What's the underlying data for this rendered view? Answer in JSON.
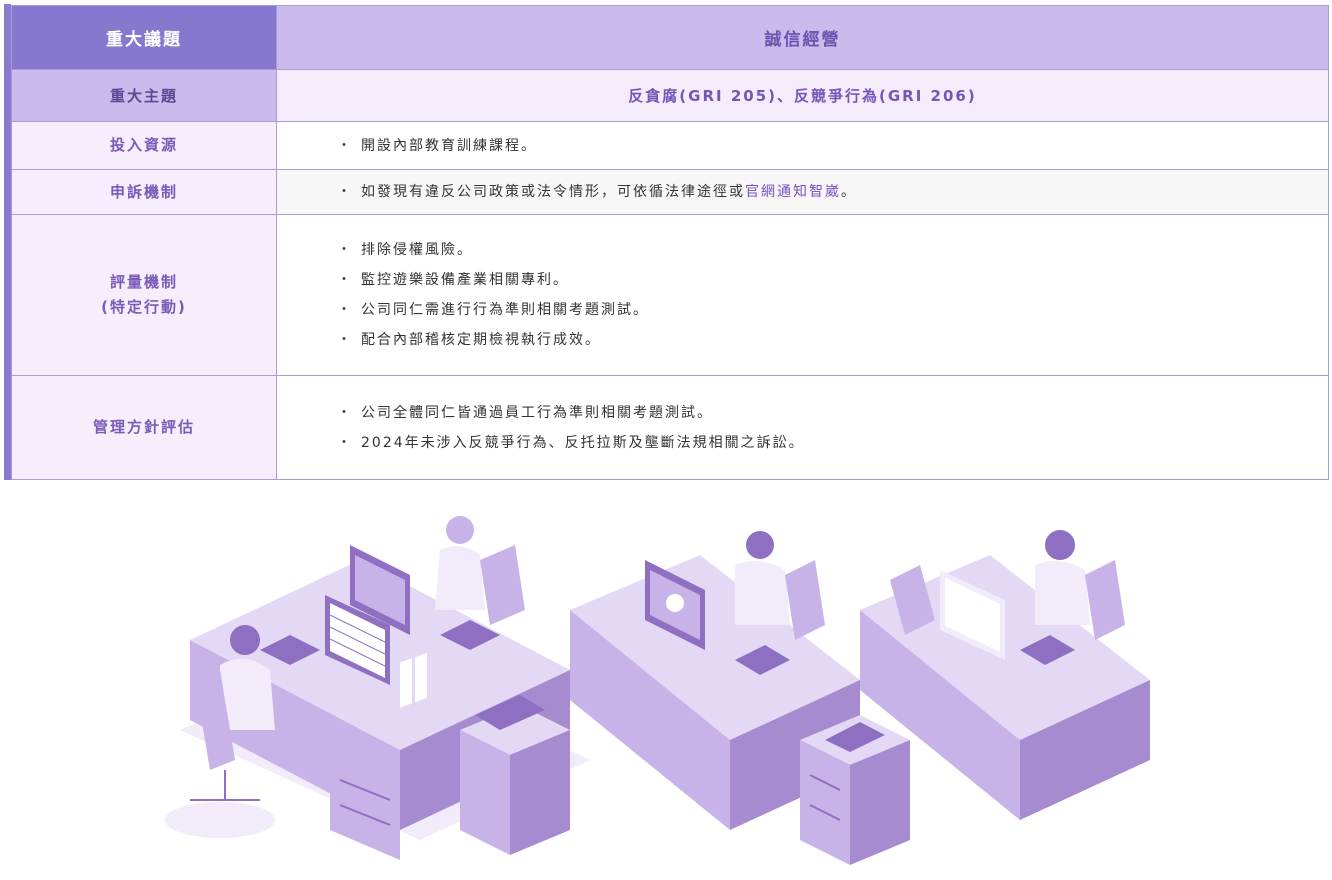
{
  "header": {
    "label": "重大議題",
    "value": "誠信經營"
  },
  "theme": {
    "label": "重大主題",
    "value": "反貪腐(GRI 205)、反競爭行為(GRI 206)"
  },
  "rows": {
    "resources": {
      "label": "投入資源",
      "items": [
        "開設內部教育訓練課程。"
      ]
    },
    "appeal": {
      "label": "申訴機制",
      "text_before": "如發現有違反公司政策或法令情形，可依循法律途徑或",
      "link": "官網通知智崴",
      "text_after": "。"
    },
    "evaluation": {
      "label_line1": "評量機制",
      "label_line2": "(特定行動)",
      "items": [
        "排除侵權風險。",
        "監控遊樂設備產業相關專利。",
        "公司同仁需進行行為準則相關考題測試。",
        "配合內部稽核定期檢視執行成效。"
      ]
    },
    "management": {
      "label": "管理方針評估",
      "items": [
        "公司全體同仁皆通過員工行為準則相關考題測試。",
        "2024年未涉入反競爭行為、反托拉斯及壟斷法規相關之訴訟。"
      ]
    }
  },
  "bullet": "・",
  "colors": {
    "accent": "#8677cf",
    "light_accent": "#cbbbec",
    "pale": "#f6eefc",
    "link": "#7a4fc0"
  },
  "illustration": {
    "icon": "office-workers-illustration"
  }
}
